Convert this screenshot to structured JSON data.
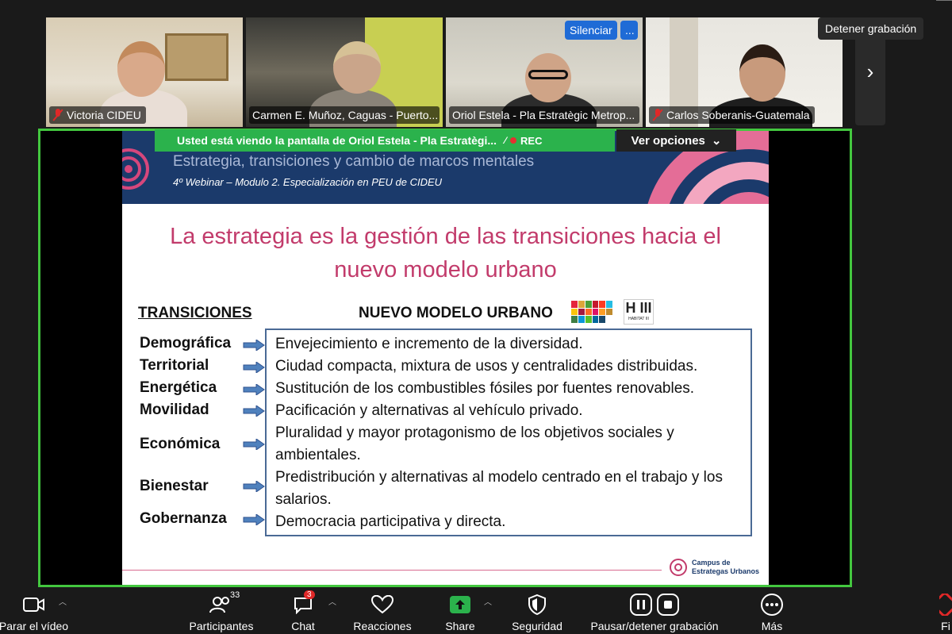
{
  "gallery": {
    "participants": [
      {
        "name": "Victoria CIDEU",
        "muted": true
      },
      {
        "name": "Carmen E. Muñoz, Caguas - Puerto...",
        "muted": false
      },
      {
        "name": "Oriol Estela - Pla Estratègic Metrop...",
        "muted": false
      },
      {
        "name": "Carlos Soberanis-Guatemala",
        "muted": true
      }
    ],
    "mute_button": "Silenciar",
    "more_button": "...",
    "stop_recording": "Detener grabación",
    "next_icon": "chevron-right-icon"
  },
  "share": {
    "banner_text": "Usted está viendo la pantalla de  Oriol Estela - Pla Estratègi...",
    "rec_label": "REC",
    "view_options": "Ver opciones"
  },
  "slide": {
    "header_title": "Estrategia, transiciones y cambio de marcos mentales",
    "header_subtitle": "4º Webinar – Modulo 2. Especialización en PEU de CIDEU",
    "title_line1": "La estrategia es la gestión de las transiciones hacia el",
    "title_line2": "nuevo modelo urbano",
    "left_heading": "TRANSICIONES",
    "right_heading": "NUEVO MODELO URBANO",
    "habitat_logo": "H III",
    "habitat_sub": "HABITAT III",
    "rows": [
      {
        "label": "Demográfica",
        "text": "Envejecimiento e incremento de la diversidad."
      },
      {
        "label": "Territorial",
        "text": "Ciudad compacta, mixtura de usos y centralidades distribuidas."
      },
      {
        "label": "Energética",
        "text": "Sustitución de los combustibles fósiles por fuentes renovables."
      },
      {
        "label": "Movilidad",
        "text": "Pacificación y alternativas al vehículo privado."
      },
      {
        "label": "Económica",
        "text": "Pluralidad y mayor protagonismo de los objetivos sociales y ambientales."
      },
      {
        "label": "Bienestar",
        "text": "Predistribución y alternativas al modelo centrado en el trabajo y los salarios."
      },
      {
        "label": "Gobernanza",
        "text": "Democracia participativa y directa."
      }
    ],
    "footer_line1": "Campus de",
    "footer_line2": "Estrategas Urbanos"
  },
  "toolbar": {
    "video": "Parar el vídeo",
    "participants": "Participantes",
    "participants_count": "33",
    "chat": "Chat",
    "chat_badge": "3",
    "reactions": "Reacciones",
    "share": "Share",
    "security": "Seguridad",
    "recording": "Pausar/detener grabación",
    "more": "Más",
    "end": "Fi"
  },
  "colors": {
    "accent_green": "#43c73f",
    "banner_green": "#2bb24c",
    "slide_pink": "#c23b6b",
    "slide_navy": "#1b3a6b"
  }
}
